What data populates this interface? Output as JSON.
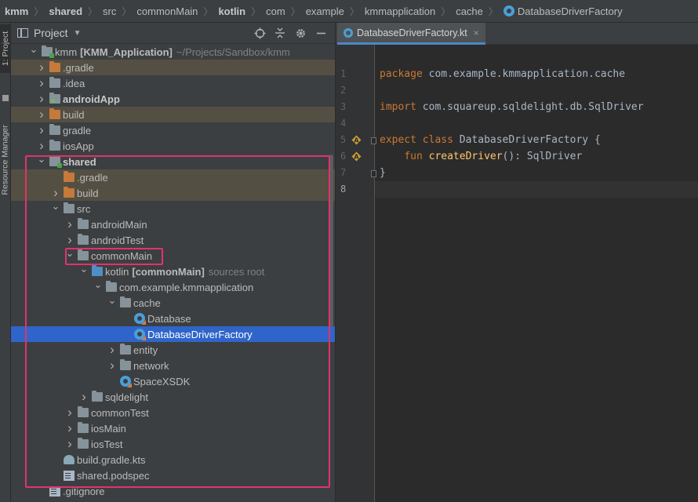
{
  "breadcrumbs": [
    {
      "label": "kmm",
      "bold": true
    },
    {
      "label": "shared",
      "bold": true
    },
    {
      "label": "src",
      "bold": false
    },
    {
      "label": "commonMain",
      "bold": false
    },
    {
      "label": "kotlin",
      "bold": true
    },
    {
      "label": "com",
      "bold": false
    },
    {
      "label": "example",
      "bold": false
    },
    {
      "label": "kmmapplication",
      "bold": false
    },
    {
      "label": "cache",
      "bold": false
    },
    {
      "label": "DatabaseDriverFactory",
      "bold": false,
      "icon": "kotlin-class-icon"
    }
  ],
  "side_strip": {
    "project_tab": "1: Project",
    "resource_tab": "Resource Manager"
  },
  "project_panel": {
    "title": "Project",
    "dropdown_icon": "chevron-down-icon",
    "tools": [
      "locate-icon",
      "collapse-icon",
      "gear-icon",
      "minimize-icon"
    ]
  },
  "tree": [
    {
      "depth": 0,
      "arrow": "down",
      "icon": "module",
      "label": "kmm",
      "suffix": "[KMM_Application]",
      "hint": "~/Projects/Sandbox/kmm",
      "tint": false,
      "selected": false
    },
    {
      "depth": 1,
      "arrow": "right",
      "icon": "folder-orange",
      "label": ".gradle",
      "tint": true
    },
    {
      "depth": 1,
      "arrow": "right",
      "icon": "folder",
      "label": ".idea"
    },
    {
      "depth": 1,
      "arrow": "right",
      "icon": "folder-android",
      "label": "androidApp",
      "bold": true
    },
    {
      "depth": 1,
      "arrow": "right",
      "icon": "folder-orange",
      "label": "build",
      "tint": true
    },
    {
      "depth": 1,
      "arrow": "right",
      "icon": "folder",
      "label": "gradle"
    },
    {
      "depth": 1,
      "arrow": "right",
      "icon": "folder",
      "label": "iosApp"
    },
    {
      "depth": 1,
      "arrow": "down",
      "icon": "module",
      "label": "shared",
      "bold": true
    },
    {
      "depth": 2,
      "arrow": "none",
      "icon": "folder-orange",
      "label": ".gradle",
      "tint": true
    },
    {
      "depth": 2,
      "arrow": "right",
      "icon": "folder-orange",
      "label": "build",
      "tint": true
    },
    {
      "depth": 2,
      "arrow": "down",
      "icon": "folder",
      "label": "src"
    },
    {
      "depth": 3,
      "arrow": "right",
      "icon": "folder",
      "label": "androidMain"
    },
    {
      "depth": 3,
      "arrow": "right",
      "icon": "folder",
      "label": "androidTest"
    },
    {
      "depth": 3,
      "arrow": "down",
      "icon": "folder",
      "label": "commonMain"
    },
    {
      "depth": 4,
      "arrow": "down",
      "icon": "folder-srcroot",
      "label": "kotlin",
      "suffix": "[commonMain]",
      "hint": "sources root"
    },
    {
      "depth": 5,
      "arrow": "down",
      "icon": "folder",
      "label": "com.example.kmmapplication"
    },
    {
      "depth": 6,
      "arrow": "down",
      "icon": "folder",
      "label": "cache"
    },
    {
      "depth": 7,
      "arrow": "none",
      "icon": "kotlin",
      "label": "Database"
    },
    {
      "depth": 7,
      "arrow": "none",
      "icon": "kotlin",
      "label": "DatabaseDriverFactory",
      "selected": true
    },
    {
      "depth": 6,
      "arrow": "right",
      "icon": "folder",
      "label": "entity"
    },
    {
      "depth": 6,
      "arrow": "right",
      "icon": "folder",
      "label": "network"
    },
    {
      "depth": 6,
      "arrow": "none",
      "icon": "kotlin",
      "label": "SpaceXSDK"
    },
    {
      "depth": 4,
      "arrow": "right",
      "icon": "folder",
      "label": "sqldelight"
    },
    {
      "depth": 3,
      "arrow": "right",
      "icon": "folder",
      "label": "commonTest"
    },
    {
      "depth": 3,
      "arrow": "right",
      "icon": "folder",
      "label": "iosMain"
    },
    {
      "depth": 3,
      "arrow": "right",
      "icon": "folder",
      "label": "iosTest"
    },
    {
      "depth": 2,
      "arrow": "none",
      "icon": "gradle-file",
      "label": "build.gradle.kts"
    },
    {
      "depth": 2,
      "arrow": "none",
      "icon": "doc-file",
      "label": "shared.podspec"
    },
    {
      "depth": 1,
      "arrow": "none",
      "icon": "doc-file",
      "label": ".gitignore"
    }
  ],
  "editor": {
    "tab_label": "DatabaseDriverFactory.kt",
    "tab_close": "×",
    "lines": [
      {
        "n": "1",
        "tokens": [
          [
            "kw",
            "package"
          ],
          [
            "t",
            " com.example.kmmapplication.cache"
          ]
        ]
      },
      {
        "n": "2",
        "tokens": []
      },
      {
        "n": "3",
        "tokens": [
          [
            "kw",
            "import"
          ],
          [
            "t",
            " com.squareup.sqldelight.db.SqlDriver"
          ]
        ]
      },
      {
        "n": "4",
        "tokens": []
      },
      {
        "n": "5",
        "tokens": [
          [
            "kw",
            "expect"
          ],
          [
            "t",
            " "
          ],
          [
            "kw",
            "class"
          ],
          [
            "t",
            " DatabaseDriverFactory {"
          ]
        ],
        "marker": "expect-marker-icon",
        "fold": true
      },
      {
        "n": "6",
        "tokens": [
          [
            "t",
            "    "
          ],
          [
            "kw",
            "fun"
          ],
          [
            "t",
            " "
          ],
          [
            "fn",
            "createDriver"
          ],
          [
            "t",
            "(): SqlDriver"
          ]
        ],
        "marker": "expect-marker-icon"
      },
      {
        "n": "7",
        "tokens": [
          [
            "t",
            "}"
          ]
        ],
        "fold": true
      },
      {
        "n": "8",
        "tokens": [],
        "current": true
      }
    ]
  },
  "colors": {
    "highlight": "#e0336a",
    "selection": "#2f65ca",
    "keyword": "#cc7832",
    "function": "#ffc66d"
  }
}
